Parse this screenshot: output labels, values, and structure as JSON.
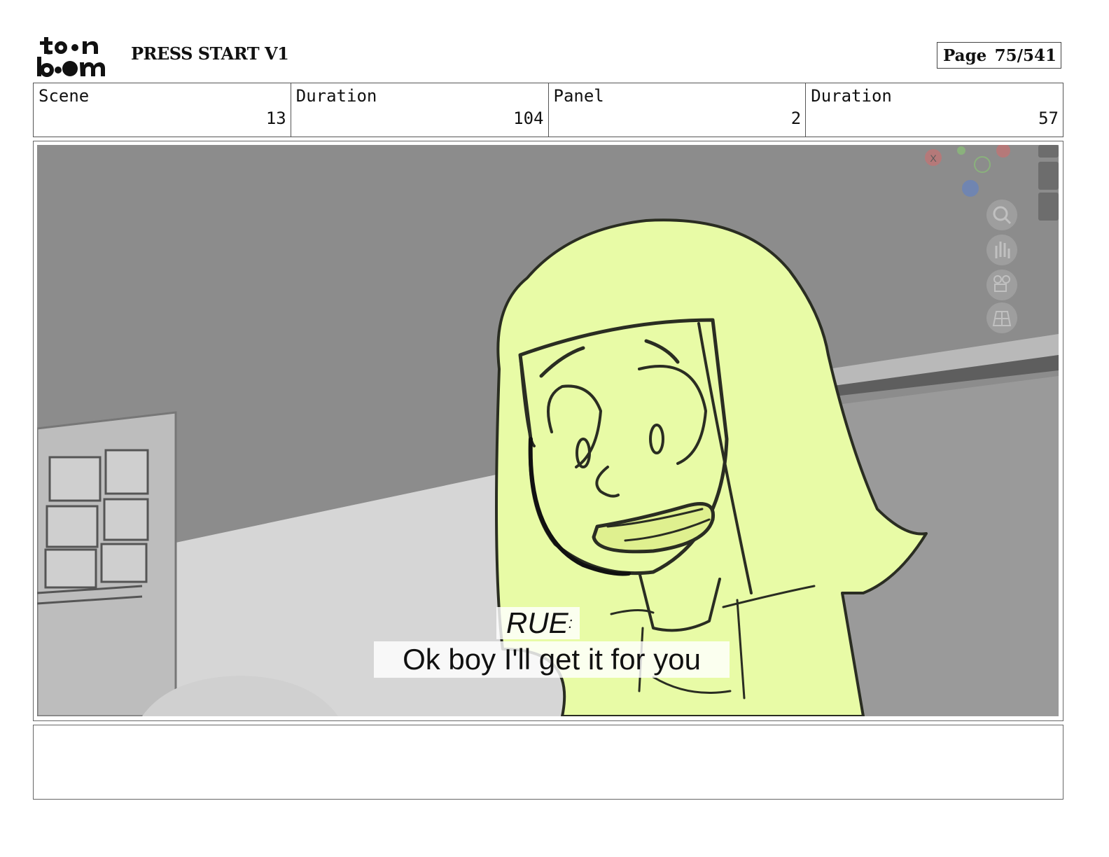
{
  "header": {
    "logo_text": "toon boom",
    "title": "PRESS START V1",
    "page_label": "Page",
    "page_value": "75/541"
  },
  "info": [
    {
      "label": "Scene",
      "value": "13"
    },
    {
      "label": "Duration",
      "value": "104"
    },
    {
      "label": "Panel",
      "value": "2"
    },
    {
      "label": "Duration",
      "value": "57"
    }
  ],
  "panel": {
    "character": "RUE",
    "speaker_suffix": ":",
    "dialogue": "Ok boy I'll get it for you",
    "viewport_gizmo": {
      "x_label": "X",
      "icons": [
        "zoom-icon",
        "pan-hand-icon",
        "camera-icon",
        "grid-icon"
      ]
    }
  },
  "notes": {
    "text": ""
  },
  "colors": {
    "character_fill": "#e8fba6",
    "line_art": "#2a2d22",
    "room_wall": "#8c8c8c",
    "room_floor": "#d8d8d8",
    "frame_border": "#666666"
  }
}
